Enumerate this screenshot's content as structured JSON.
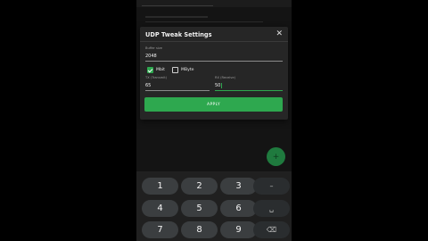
{
  "dialog": {
    "title": "UDP Tweak Settings",
    "close_glyph": "✕",
    "buffer_size_label": "Buffer size",
    "buffer_size_value": "2048",
    "unit_mbit_label": "Mbit",
    "unit_mbit_checked": true,
    "unit_mbyte_label": "MByte",
    "unit_mbyte_checked": false,
    "tx_label": "TX (Transmit)",
    "tx_value": "65",
    "rx_label": "RX (Receive)",
    "rx_value": "50",
    "apply_label": "APPLY"
  },
  "fab": {
    "icon": "plus-icon",
    "glyph": "+"
  },
  "keypad": {
    "keys": [
      "1",
      "2",
      "3",
      "4",
      "5",
      "6",
      "7",
      "8",
      "9"
    ],
    "minus_glyph": "–",
    "space_glyph": "␣",
    "backspace_glyph": "⌫"
  },
  "colors": {
    "accent": "#2ea84f",
    "dialog_bg": "#262626",
    "key_bg": "#3b3e40"
  }
}
